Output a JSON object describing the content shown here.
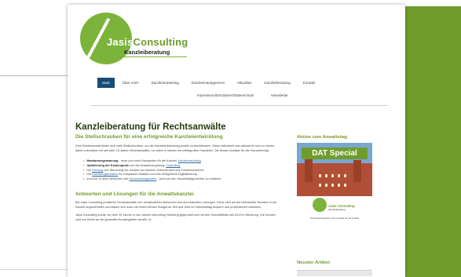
{
  "logo": {
    "name_part1": "Jasis",
    "name_part2": "Consulting",
    "subtitle": "Kanzleiberatung"
  },
  "nav": {
    "row1": [
      "Start",
      "Über mich",
      "Kanzleimarketing",
      "Kanzleimanagement",
      "Aktuelles",
      "Kanzleiberatung",
      "Kontakt"
    ],
    "row2": [
      "Impressum/Disclaimer/Datenschutz",
      "Newsletter"
    ],
    "active_index": 0
  },
  "main": {
    "title": "Kanzleiberatung für Rechtsanwälte",
    "subtitle": "Die Stellschrauben für eine erfolgreiche Kanzleientwicklung",
    "intro": "Dem Rechtsanwalt bieten sich viele Stellschrauben, um die Kanzleientwicklung positiv zu beeinflussen. Diese individuell und optimal für sich zu nutzen, dabei unterstütze ich seit über 15 Jahren Rechtsanwälte, vor allem in kleinen bis mittelgroßen Kanzleien. Die besten Ansätze für den Kanzleierfolg:",
    "bullets": [
      {
        "bold": "Mandantengewinnung",
        "text": " - neue und mehr Mandanten für die Kanzlei: ",
        "link": "Kanzleimarketing",
        "tail": ""
      },
      {
        "bold": "Optimierung der Kostenquote",
        "text": " und der Anwaltsvergütung: ",
        "link": "Controlling",
        "tail": ""
      },
      {
        "bold": "",
        "text": "Die ",
        "link": "Führung",
        "tail": " und Steuerung der Kanzlei zur höheren Zufriedenheit und Friedensicherheit"
      },
      {
        "bold": "",
        "text": "Die ",
        "link": "Kanzleiorganisation",
        "tail": " für entspannte Abläufe und eine erfolgreiche Digitalisierung"
      },
      {
        "bold": "",
        "text": "kurz/um: In allen Bereichen des ",
        "link": "Kanzleimanagement",
        "tail": " - auch um den Kanzleialltag leichter zu meistern"
      }
    ],
    "section_title": "Antworten und Lösungen für die Anwaltskanzlei",
    "section_text": "Bei Jasis Consulting profitieren Rechtsanwälte von verständlichen Antworten und durchdachten Lösungen. Diese sind auf die individuelle Situation in der Kanzlei zugeschnitten und lassen sich auch mit einem kleinen Budget an Zeit und Geld im Kanzleialltag bequem und professionell umsetzen.",
    "section_text2": "Jasis Consulting wurde vor über 15 Jahren in von Jasmin Isphording Nürnberg gegründet und hat den Geschäftssitz seit 2013 in Würzburg. Die Kunden sind von Berlin an die gesamten Bundesgebiet verteilt. Je"
  },
  "sidebar": {
    "promo_heading": "Aktion zum Anwaltstag:",
    "ad_title": "DAT Special",
    "ad_brand": "Jasis Consulting",
    "ad_brand_sub": "Kanzleiberatung",
    "ad_footer": "Schnupperangebot: Nur buchbar bis 30.6.2023",
    "news_heading": "Neuster Artikel:"
  }
}
